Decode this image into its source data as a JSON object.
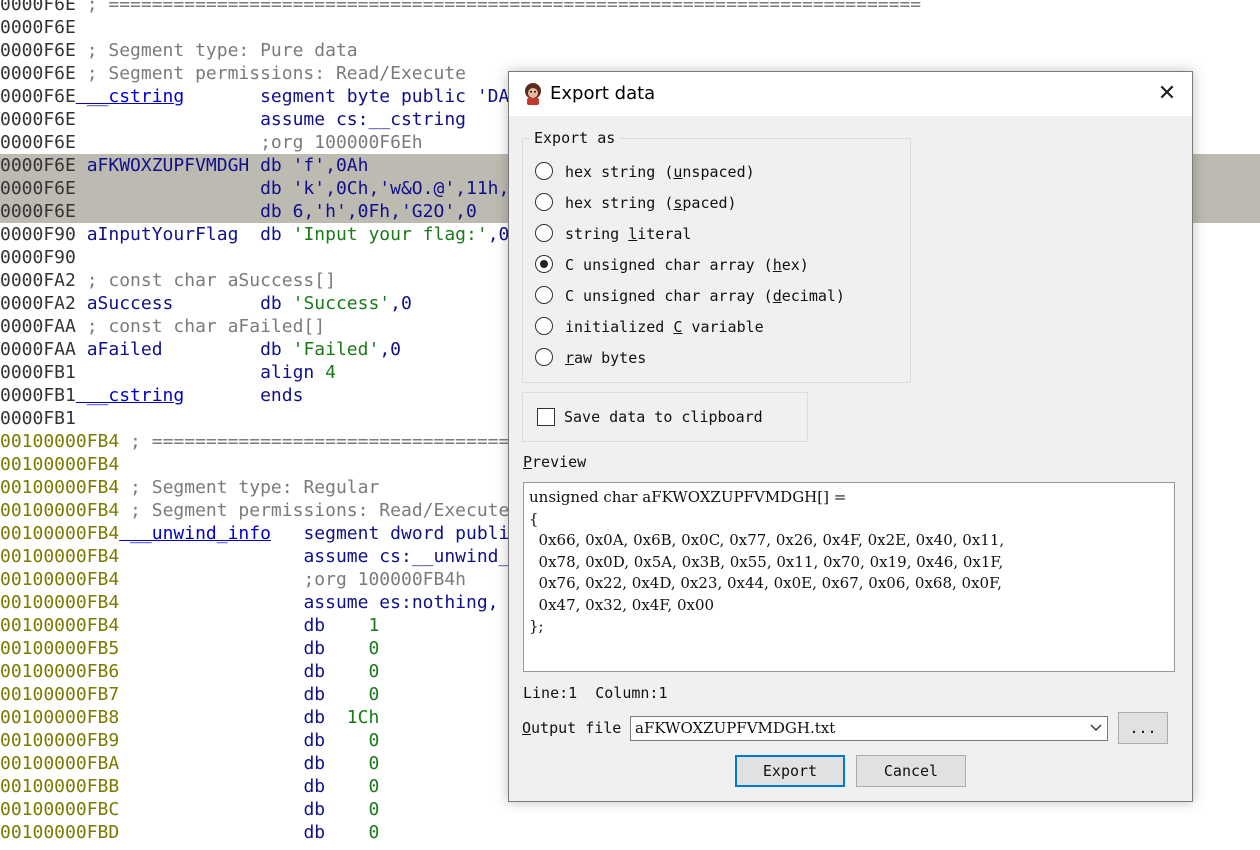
{
  "disassembly": {
    "lines": [
      {
        "addr": "0000F6E",
        "parts": [
          {
            "t": " ; ===========================================================================",
            "c": "cmt"
          }
        ]
      },
      {
        "addr": "0000F6E",
        "parts": []
      },
      {
        "addr": "0000F6E",
        "parts": [
          {
            "t": " ; Segment type: Pure data",
            "c": "cmt"
          }
        ]
      },
      {
        "addr": "0000F6E",
        "parts": [
          {
            "t": " ; Segment permissions: Read/Execute",
            "c": "cmt"
          }
        ]
      },
      {
        "addr": "0000F6E",
        "parts": [
          {
            "t": " __cstring",
            "c": "blue",
            "u": true
          },
          {
            "t": "       segment byte public 'DA",
            "c": "navy"
          }
        ]
      },
      {
        "addr": "0000F6E",
        "parts": [
          {
            "t": "                 assume cs:__cstring",
            "c": "navy"
          }
        ]
      },
      {
        "addr": "0000F6E",
        "parts": [
          {
            "t": "                 ;org 100000F6Eh",
            "c": "cmt"
          }
        ]
      },
      {
        "addr": "0000F6E",
        "hl": true,
        "parts": [
          {
            "t": " aFKWOXZUPFVMDGH db 'f',0Ah",
            "c": "navy"
          }
        ]
      },
      {
        "addr": "0000F6E",
        "hl": true,
        "parts": [
          {
            "t": "                 db 'k',0Ch,'w&O.@',11h,",
            "c": "navy"
          }
        ]
      },
      {
        "addr": "0000F6E",
        "hl": true,
        "parts": [
          {
            "t": "                 db 6,'h',0Fh,'G2O',0",
            "c": "navy"
          }
        ]
      },
      {
        "addr": "0000F90",
        "parts": [
          {
            "t": " aInputYourFlag",
            "c": "navy"
          },
          {
            "t": "  db ",
            "c": "navy"
          },
          {
            "t": "'Input your flag:'",
            "c": "green"
          },
          {
            "t": ",0",
            "c": "navy"
          }
        ]
      },
      {
        "addr": "0000F90",
        "parts": []
      },
      {
        "addr": "0000FA2",
        "parts": [
          {
            "t": " ; const char aSuccess[]",
            "c": "cmt"
          }
        ]
      },
      {
        "addr": "0000FA2",
        "parts": [
          {
            "t": " aSuccess        db ",
            "c": "navy"
          },
          {
            "t": "'Success'",
            "c": "green"
          },
          {
            "t": ",0",
            "c": "navy"
          }
        ]
      },
      {
        "addr": "0000FAA",
        "parts": [
          {
            "t": " ; const char aFailed[]",
            "c": "cmt"
          }
        ]
      },
      {
        "addr": "0000FAA",
        "parts": [
          {
            "t": " aFailed         db ",
            "c": "navy"
          },
          {
            "t": "'Failed'",
            "c": "green"
          },
          {
            "t": ",0",
            "c": "navy"
          }
        ]
      },
      {
        "addr": "0000FB1",
        "parts": [
          {
            "t": "                 align ",
            "c": "navy"
          },
          {
            "t": "4",
            "c": "green"
          }
        ]
      },
      {
        "addr": "0000FB1",
        "parts": [
          {
            "t": " __cstring",
            "c": "blue",
            "u": true
          },
          {
            "t": "       ends",
            "c": "navy"
          }
        ]
      },
      {
        "addr": "0000FB1",
        "parts": []
      },
      {
        "addr": "00100000FB4",
        "y": true,
        "parts": [
          {
            "t": " ; ===================================",
            "c": "cmt"
          }
        ]
      },
      {
        "addr": "00100000FB4",
        "y": true,
        "parts": []
      },
      {
        "addr": "00100000FB4",
        "y": true,
        "parts": [
          {
            "t": " ; Segment type: Regular",
            "c": "cmt"
          }
        ]
      },
      {
        "addr": "00100000FB4",
        "y": true,
        "parts": [
          {
            "t": " ; Segment permissions: Read/Execute",
            "c": "cmt"
          }
        ]
      },
      {
        "addr": "00100000FB4",
        "y": true,
        "parts": [
          {
            "t": " __unwind_info",
            "c": "blue",
            "u": true
          },
          {
            "t": "   segment dword publi",
            "c": "navy"
          }
        ]
      },
      {
        "addr": "00100000FB4",
        "y": true,
        "parts": [
          {
            "t": "                 assume cs:__unwind_",
            "c": "navy"
          }
        ]
      },
      {
        "addr": "00100000FB4",
        "y": true,
        "parts": [
          {
            "t": "                 ;org 100000FB4h",
            "c": "cmt"
          }
        ]
      },
      {
        "addr": "00100000FB4",
        "y": true,
        "parts": [
          {
            "t": "                 assume es:nothing, ",
            "c": "navy"
          }
        ]
      },
      {
        "addr": "00100000FB4",
        "y": true,
        "parts": [
          {
            "t": "                 db    ",
            "c": "navy"
          },
          {
            "t": "1",
            "c": "green"
          }
        ]
      },
      {
        "addr": "00100000FB5",
        "y": true,
        "parts": [
          {
            "t": "                 db    ",
            "c": "navy"
          },
          {
            "t": "0",
            "c": "green"
          }
        ]
      },
      {
        "addr": "00100000FB6",
        "y": true,
        "parts": [
          {
            "t": "                 db    ",
            "c": "navy"
          },
          {
            "t": "0",
            "c": "green"
          }
        ]
      },
      {
        "addr": "00100000FB7",
        "y": true,
        "parts": [
          {
            "t": "                 db    ",
            "c": "navy"
          },
          {
            "t": "0",
            "c": "green"
          }
        ]
      },
      {
        "addr": "00100000FB8",
        "y": true,
        "parts": [
          {
            "t": "                 db  ",
            "c": "navy"
          },
          {
            "t": "1Ch",
            "c": "green"
          }
        ]
      },
      {
        "addr": "00100000FB9",
        "y": true,
        "parts": [
          {
            "t": "                 db    ",
            "c": "navy"
          },
          {
            "t": "0",
            "c": "green"
          }
        ]
      },
      {
        "addr": "00100000FBA",
        "y": true,
        "parts": [
          {
            "t": "                 db    ",
            "c": "navy"
          },
          {
            "t": "0",
            "c": "green"
          }
        ]
      },
      {
        "addr": "00100000FBB",
        "y": true,
        "parts": [
          {
            "t": "                 db    ",
            "c": "navy"
          },
          {
            "t": "0",
            "c": "green"
          }
        ]
      },
      {
        "addr": "00100000FBC",
        "y": true,
        "parts": [
          {
            "t": "                 db    ",
            "c": "navy"
          },
          {
            "t": "0",
            "c": "green"
          }
        ]
      },
      {
        "addr": "00100000FBD",
        "y": true,
        "parts": [
          {
            "t": "                 db    ",
            "c": "navy"
          },
          {
            "t": "0",
            "c": "green"
          }
        ]
      }
    ]
  },
  "dialog": {
    "title": "Export data",
    "close_icon": "close-icon",
    "export_as": {
      "label": "Export as",
      "options": [
        {
          "pre": "hex string (",
          "acc": "u",
          "post": "nspaced)",
          "selected": false
        },
        {
          "pre": "hex string (",
          "acc": "s",
          "post": "paced)",
          "selected": false
        },
        {
          "pre": "string ",
          "acc": "l",
          "post": "iteral",
          "selected": false
        },
        {
          "pre": "C unsigned char array (",
          "acc": "h",
          "post": "ex)",
          "selected": true
        },
        {
          "pre": "C unsigned char array (",
          "acc": "d",
          "post": "ecimal)",
          "selected": false
        },
        {
          "pre": "initialized ",
          "acc": "C",
          "post": " variable",
          "selected": false
        },
        {
          "pre": "",
          "acc": "r",
          "post": "aw bytes",
          "selected": false
        }
      ]
    },
    "save_clipboard": {
      "label": "Save data to clipboard",
      "checked": false
    },
    "preview": {
      "label_acc": "P",
      "label_rest": "review",
      "lines": [
        "unsigned char aFKWOXZUPFVMDGH[] =",
        "{",
        "  0x66, 0x0A, 0x6B, 0x0C, 0x77, 0x26, 0x4F, 0x2E, 0x40, 0x11,",
        "  0x78, 0x0D, 0x5A, 0x3B, 0x55, 0x11, 0x70, 0x19, 0x46, 0x1F,",
        "  0x76, 0x22, 0x4D, 0x23, 0x44, 0x0E, 0x67, 0x06, 0x68, 0x0F,",
        "  0x47, 0x32, 0x4F, 0x00",
        "};"
      ]
    },
    "status": {
      "line": "Line:1",
      "column": "Column:1"
    },
    "output_file": {
      "label_acc": "O",
      "label_rest": "utput file",
      "value": "aFKWOXZUPFVMDGH.txt",
      "browse_label": "..."
    },
    "buttons": {
      "export": "Export",
      "cancel": "Cancel"
    }
  }
}
